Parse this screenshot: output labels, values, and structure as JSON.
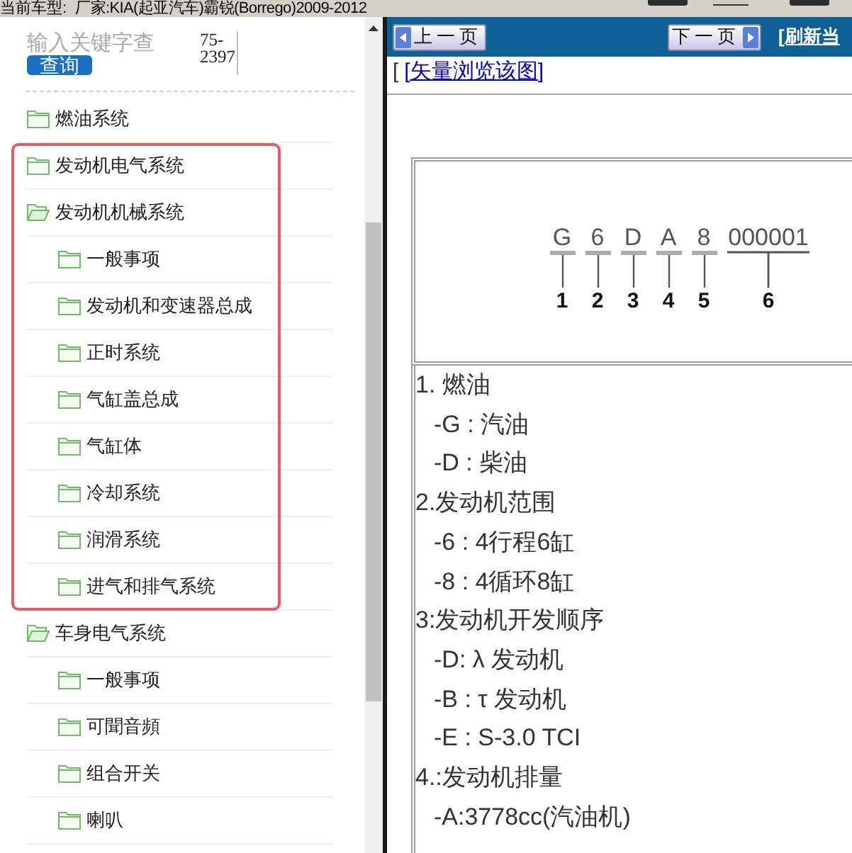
{
  "top_bar": {
    "label": "当前车型:",
    "value": "厂家:KIA(起亚汽车)霸锐(Borrego)2009-2012"
  },
  "search": {
    "placeholder": "输入关键字查",
    "button": "查询",
    "code": "75-2397"
  },
  "tree": [
    {
      "label": "燃油系统",
      "expanded": false,
      "highlighted": false
    },
    {
      "label": "发动机电气系统",
      "expanded": false,
      "highlighted": true
    },
    {
      "label": "发动机机械系统",
      "expanded": true,
      "highlighted": true,
      "children": [
        {
          "label": "一般事项",
          "expanded": false
        },
        {
          "label": "发动机和变速器总成",
          "expanded": false
        },
        {
          "label": "正时系统",
          "expanded": false
        },
        {
          "label": "气缸盖总成",
          "expanded": false
        },
        {
          "label": "气缸体",
          "expanded": false
        },
        {
          "label": "冷却系统",
          "expanded": false
        },
        {
          "label": "润滑系统",
          "expanded": false
        },
        {
          "label": "进气和排气系统",
          "expanded": false
        }
      ]
    },
    {
      "label": "车身电气系统",
      "expanded": true,
      "highlighted": false,
      "children": [
        {
          "label": "一般事项",
          "expanded": false
        },
        {
          "label": "可聞音頻",
          "expanded": false
        },
        {
          "label": "组合开关",
          "expanded": false
        },
        {
          "label": "喇叭",
          "expanded": false
        }
      ]
    }
  ],
  "viewer": {
    "prev_button": "上一页",
    "next_button": "下一页",
    "refresh_link": "[刷新当",
    "bracket": "[",
    "vector_link": "[矢量浏览该图]",
    "diagram": {
      "segments": [
        {
          "code": "G",
          "number": "1",
          "kind": "char"
        },
        {
          "code": "6",
          "number": "2",
          "kind": "char"
        },
        {
          "code": "D",
          "number": "3",
          "kind": "char"
        },
        {
          "code": "A",
          "number": "4",
          "kind": "char"
        },
        {
          "code": "8",
          "number": "5",
          "kind": "char"
        },
        {
          "code": "000001",
          "number": "6",
          "kind": "serial"
        }
      ]
    },
    "sections": [
      {
        "heading": "1. 燃油",
        "items": [
          "-G : 汽油",
          "-D : 柴油"
        ]
      },
      {
        "heading": "2.发动机范围",
        "items": [
          "-6 : 4行程6缸",
          "-8 : 4循环8缸"
        ]
      },
      {
        "heading": "3:发动机开发顺序",
        "items": [
          "-D: λ 发动机",
          "-B : τ 发动机",
          "-E : S-3.0 TCI"
        ]
      },
      {
        "heading": "4.:发动机排量",
        "items": [
          "-A:3778cc(汽油机)"
        ]
      }
    ]
  }
}
